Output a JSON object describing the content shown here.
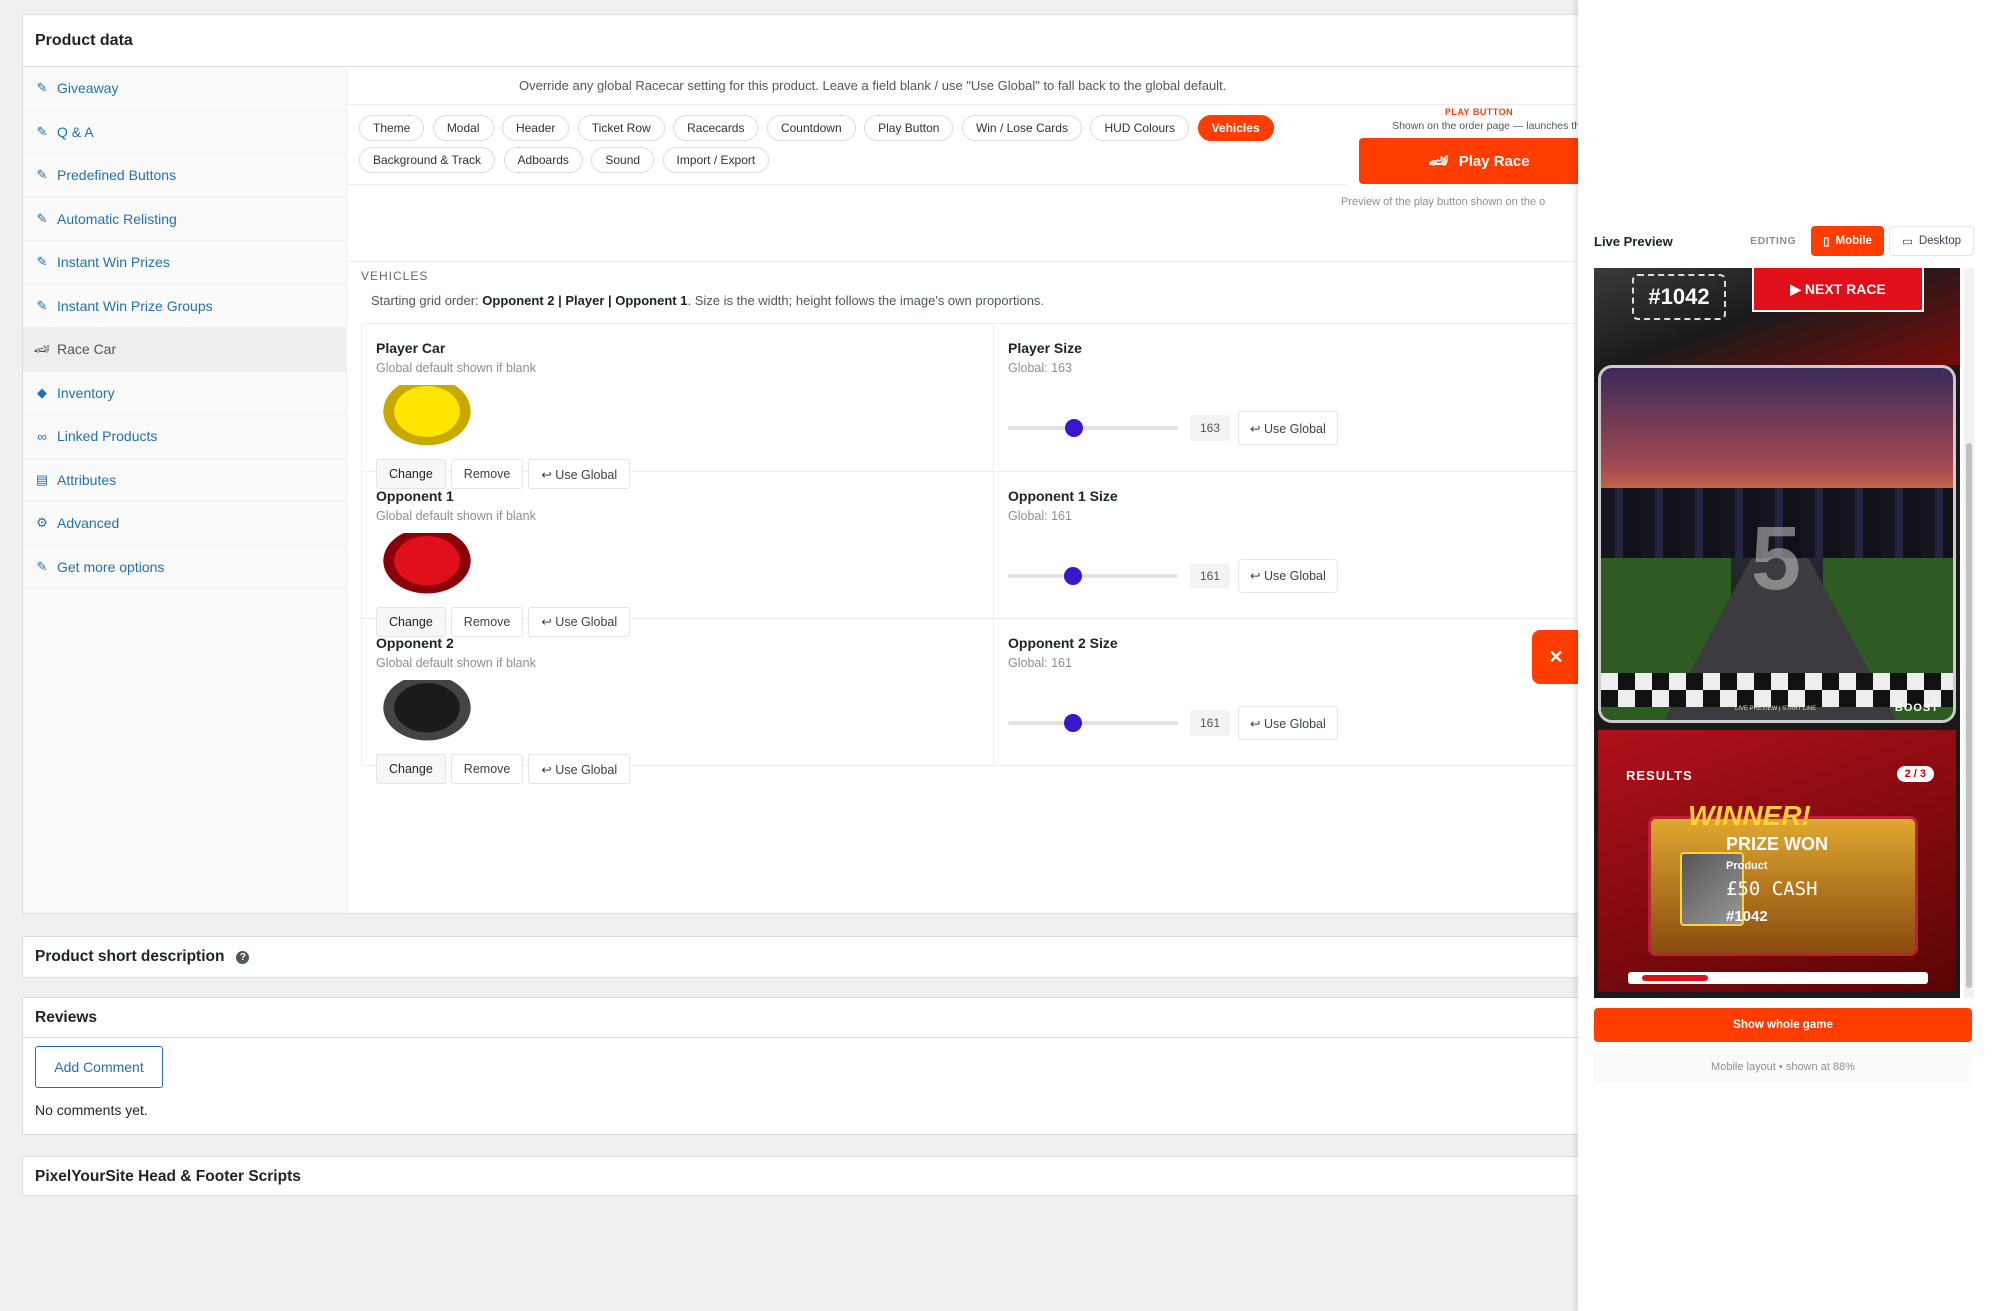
{
  "product_data": {
    "title": "Product data",
    "sidebar": [
      {
        "label": "Giveaway",
        "icon": "wrench-icon"
      },
      {
        "label": "Q & A",
        "icon": "wrench-icon"
      },
      {
        "label": "Predefined Buttons",
        "icon": "wrench-icon"
      },
      {
        "label": "Automatic Relisting",
        "icon": "wrench-icon"
      },
      {
        "label": "Instant Win Prizes",
        "icon": "wrench-icon"
      },
      {
        "label": "Instant Win Prize Groups",
        "icon": "wrench-icon"
      },
      {
        "label": "Race Car",
        "icon": "car-icon"
      },
      {
        "label": "Inventory",
        "icon": "tag-icon"
      },
      {
        "label": "Linked Products",
        "icon": "link-icon"
      },
      {
        "label": "Attributes",
        "icon": "list-icon"
      },
      {
        "label": "Advanced",
        "icon": "gear-icon"
      },
      {
        "label": "Get more options",
        "icon": "plugin-icon"
      }
    ],
    "override_note": "Override any global Racecar setting for this product. Leave a field blank / use \"Use Global\" to fall back to the global default.",
    "tabs": [
      "Theme",
      "Modal",
      "Header",
      "Ticket Row",
      "Racecards",
      "Countdown",
      "Play Button",
      "Win / Lose Cards",
      "HUD Colours",
      "Vehicles",
      "Background & Track",
      "Adboards",
      "Sound",
      "Import / Export"
    ],
    "active_tab": "Vehicles",
    "play_button": {
      "label": "PLAY BUTTON",
      "sub": "Shown on the order page — launches the",
      "button_text": "Play Race",
      "preview_note": "Preview of the play button shown on the o"
    },
    "vehicles": {
      "title": "VEHICLES",
      "desc_prefix": "Starting grid order: ",
      "desc_order": "Opponent 2 | Player | Opponent 1",
      "desc_suffix": ". Size is the width; height follows the image's own proportions.",
      "rows": [
        {
          "name": "Player Car",
          "sub": "Global default shown if blank",
          "size_label": "Player Size",
          "global": "Global: 163",
          "value": "163",
          "fraction": 0.39
        },
        {
          "name": "Opponent 1",
          "sub": "Global default shown if blank",
          "size_label": "Opponent 1 Size",
          "global": "Global: 161",
          "value": "161",
          "fraction": 0.38
        },
        {
          "name": "Opponent 2",
          "sub": "Global default shown if blank",
          "size_label": "Opponent 2 Size",
          "global": "Global: 161",
          "value": "161",
          "fraction": 0.38
        }
      ],
      "change": "Change",
      "remove": "Remove",
      "use_global": "↩ Use Global"
    }
  },
  "short_desc": {
    "title": "Product short description"
  },
  "reviews": {
    "title": "Reviews",
    "add_comment": "Add Comment",
    "empty": "No comments yet."
  },
  "pixel": {
    "title": "PixelYourSite Head & Footer Scripts"
  },
  "live_preview": {
    "title": "Live Preview",
    "editing": "EDITING",
    "mobile": "Mobile",
    "desktop": "Desktop",
    "game": {
      "id": "#1042",
      "next_race": "▶ NEXT RACE",
      "countdown": "5",
      "boost": "BOOST",
      "start_label": "LIVE PREVIEW | START LINE",
      "results": "RESULTS",
      "results_count": "2 / 3",
      "winner": "WINNER!",
      "prize_won": "PRIZE WON",
      "product": "Product",
      "cash": "£50 CASH",
      "ticket": "#1042"
    },
    "show_whole": "Show whole game",
    "layout_note": "Mobile layout • shown at 88%"
  },
  "colors": {
    "accent": "#ff3d00",
    "link": "#2271b1",
    "slider": "#3b17c9"
  }
}
